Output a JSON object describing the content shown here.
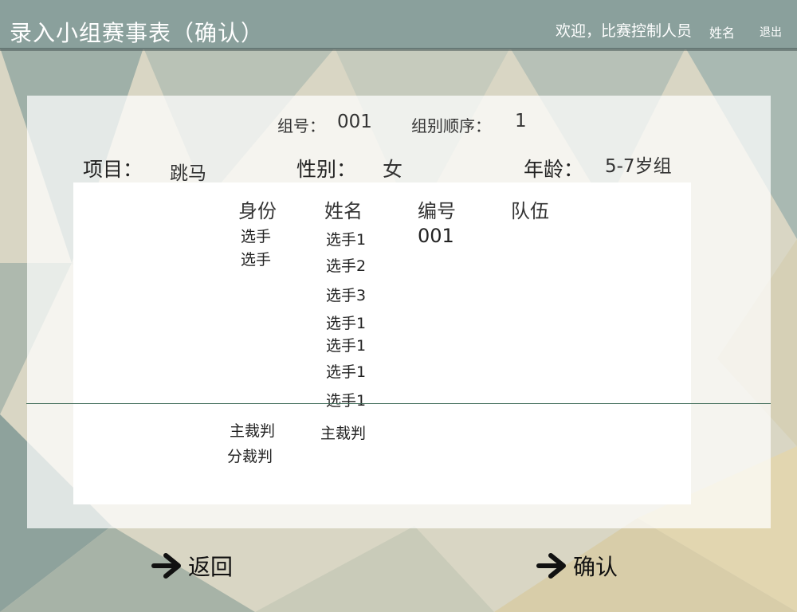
{
  "header": {
    "title": "录入小组赛事表（确认）",
    "welcome": "欢迎，比赛控制人员",
    "user_name": "姓名",
    "logout": "退出"
  },
  "info": {
    "group_no_label": "组号：",
    "group_no": "001",
    "group_order_label": "组别顺序：",
    "group_order": "1",
    "event_label": "项目：",
    "event": "跳马",
    "gender_label": "性别：",
    "gender": "女",
    "age_label": "年龄：",
    "age_group": "5-7岁组"
  },
  "table": {
    "headers": [
      "身份",
      "姓名",
      "编号",
      "队伍"
    ],
    "athlete_roles": [
      "选手",
      "选手"
    ],
    "athlete_names": [
      "选手1",
      "选手2",
      "选手3",
      "选手1",
      "选手1",
      "选手1",
      "选手1"
    ],
    "numbers": [
      "001"
    ],
    "judge_roles": [
      "主裁判",
      "分裁判"
    ],
    "judge_names": [
      "主裁判"
    ]
  },
  "actions": {
    "back": "返回",
    "confirm": "确认",
    "arrow_icon": "arrow-right-icon"
  },
  "colors": {
    "header_bg": "#8aa09c",
    "divider": "#3f6b58"
  }
}
